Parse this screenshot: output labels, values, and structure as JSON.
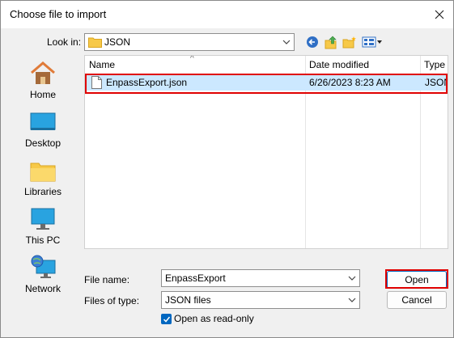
{
  "dialog": {
    "title": "Choose file to import",
    "close_icon": "close-icon"
  },
  "lookin": {
    "label": "Look in:",
    "value": "JSON"
  },
  "toolbar": {
    "back_icon": "back-icon",
    "up_icon": "up-folder-icon",
    "newfolder_icon": "new-folder-icon",
    "view_icon": "view-menu-icon"
  },
  "places": [
    {
      "label": "Home",
      "icon": "home-icon"
    },
    {
      "label": "Desktop",
      "icon": "desktop-icon"
    },
    {
      "label": "Libraries",
      "icon": "libraries-icon"
    },
    {
      "label": "This PC",
      "icon": "this-pc-icon"
    },
    {
      "label": "Network",
      "icon": "network-icon"
    }
  ],
  "filelist": {
    "columns": {
      "name": "Name",
      "date": "Date modified",
      "type": "Type"
    },
    "files": [
      {
        "name": "EnpassExport.json",
        "date": "6/26/2023 8:23 AM",
        "type": "JSON"
      }
    ]
  },
  "filename": {
    "label": "File name:",
    "value": "EnpassExport"
  },
  "filetype": {
    "label": "Files of type:",
    "value": "JSON files"
  },
  "readonly": {
    "label": "Open as read-only",
    "checked": true
  },
  "buttons": {
    "open": "Open",
    "cancel": "Cancel"
  },
  "colors": {
    "selection": "#cce8ff",
    "highlight": "#e00000",
    "accent": "#0067c0"
  }
}
